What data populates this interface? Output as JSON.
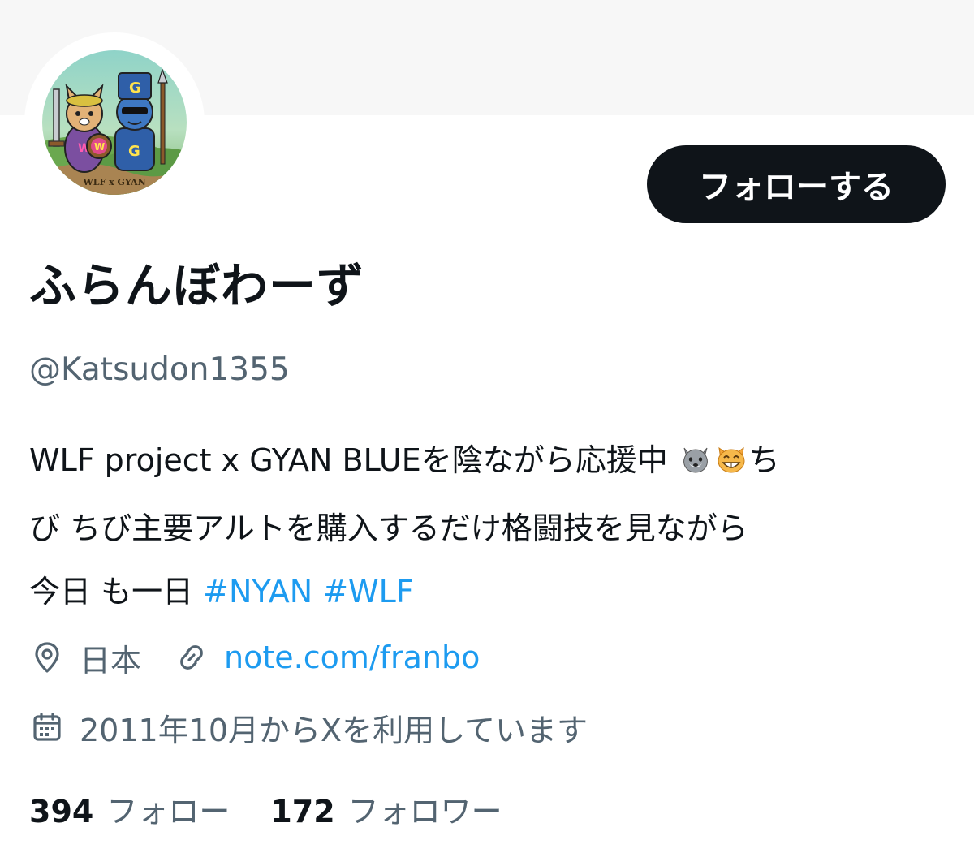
{
  "profile": {
    "display_name": "ふらんぼわーず",
    "handle": "@Katsudon1355",
    "avatar_caption": "WLF x GYAN",
    "follow_button_label": "フォローする"
  },
  "bio": {
    "line1_text": "WLF project x GYAN BLUEを陰ながら応援中 ",
    "line1_emoji_wolf": "wolf-emoji",
    "line1_emoji_cat": "grinning-cat-emoji",
    "line1_tail": "ち",
    "line2": "び ちび主要アルトを購入するだけ格闘技を見ながら",
    "line3_text": "今日 も一日 ",
    "hashtag1": "#NYAN",
    "hashtag2": "#WLF"
  },
  "meta": {
    "location_icon": "location-pin-icon",
    "location": "日本",
    "link_icon": "link-icon",
    "link": "note.com/franbo",
    "joined_icon": "calendar-icon",
    "joined": "2011年10月からXを利用しています"
  },
  "stats": {
    "following_count": "394",
    "following_label": "フォロー",
    "followers_count": "172",
    "followers_label": "フォロワー"
  },
  "colors": {
    "accent": "#1d9bf0",
    "text_primary": "#0f1419",
    "text_secondary": "#536471",
    "button_bg": "#0f1419",
    "banner_bg": "#f7f7f7"
  }
}
